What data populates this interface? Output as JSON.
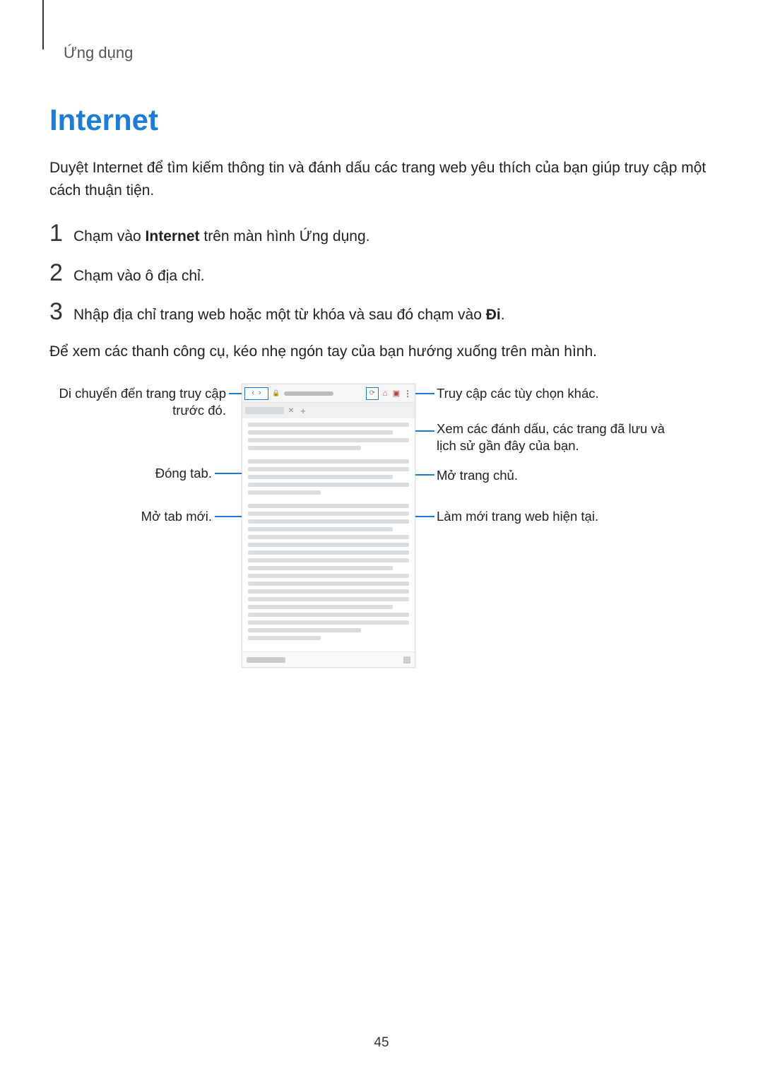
{
  "breadcrumb": "Ứng dụng",
  "title": "Internet",
  "intro": "Duyệt Internet để tìm kiếm thông tin và đánh dấu các trang web yêu thích của bạn giúp truy cập một cách thuận tiện.",
  "steps": {
    "s1_num": "1",
    "s1_a": "Chạm vào ",
    "s1_b": "Internet",
    "s1_c": " trên màn hình Ứng dụng.",
    "s2_num": "2",
    "s2": "Chạm vào ô địa chỉ.",
    "s3_num": "3",
    "s3_a": "Nhập địa chỉ trang web hoặc một từ khóa và sau đó chạm vào ",
    "s3_b": "Đi",
    "s3_c": "."
  },
  "post_steps": "Để xem các thanh công cụ, kéo nhẹ ngón tay của bạn hướng xuống trên màn hình.",
  "callouts": {
    "left1": "Di chuyển đến trang truy cập trước đó.",
    "left2": "Đóng tab.",
    "left3": "Mở tab mới.",
    "right1": "Truy cập các tùy chọn khác.",
    "right2": "Xem các đánh dấu, các trang đã lưu và lịch sử gần đây của bạn.",
    "right3": "Mở trang chủ.",
    "right4": "Làm mới trang web hiện tại."
  },
  "page_number": "45"
}
